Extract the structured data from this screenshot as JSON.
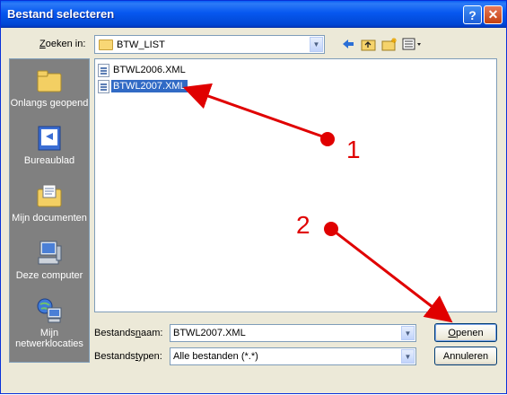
{
  "window": {
    "title": "Bestand selecteren"
  },
  "toolbar": {
    "lookin_label": "Zoeken in:",
    "lookin_accesskey": "Z",
    "lookin_rest": "oeken in:",
    "current_folder": "BTW_LIST"
  },
  "places": [
    {
      "label": "Onlangs geopend",
      "icon": "recent-folder-icon"
    },
    {
      "label": "Bureaublad",
      "icon": "desktop-icon"
    },
    {
      "label": "Mijn documenten",
      "icon": "my-documents-icon"
    },
    {
      "label": "Deze computer",
      "icon": "computer-icon"
    },
    {
      "label": "Mijn netwerklocaties",
      "icon": "network-icon"
    }
  ],
  "files": [
    {
      "name": "BTWL2006.XML",
      "selected": false
    },
    {
      "name": "BTWL2007.XML",
      "selected": true
    }
  ],
  "filename": {
    "label_pre": "Bestands",
    "label_key": "n",
    "label_post": "aam:",
    "value": "BTWL2007.XML"
  },
  "filetype": {
    "label_pre": "Bestands",
    "label_key": "t",
    "label_post": "ypen:",
    "value": "Alle bestanden (*.*)"
  },
  "buttons": {
    "open_key": "O",
    "open_rest": "penen",
    "cancel": "Annuleren"
  },
  "annotations": {
    "marker1": "1",
    "marker2": "2",
    "color": "#e00000"
  }
}
